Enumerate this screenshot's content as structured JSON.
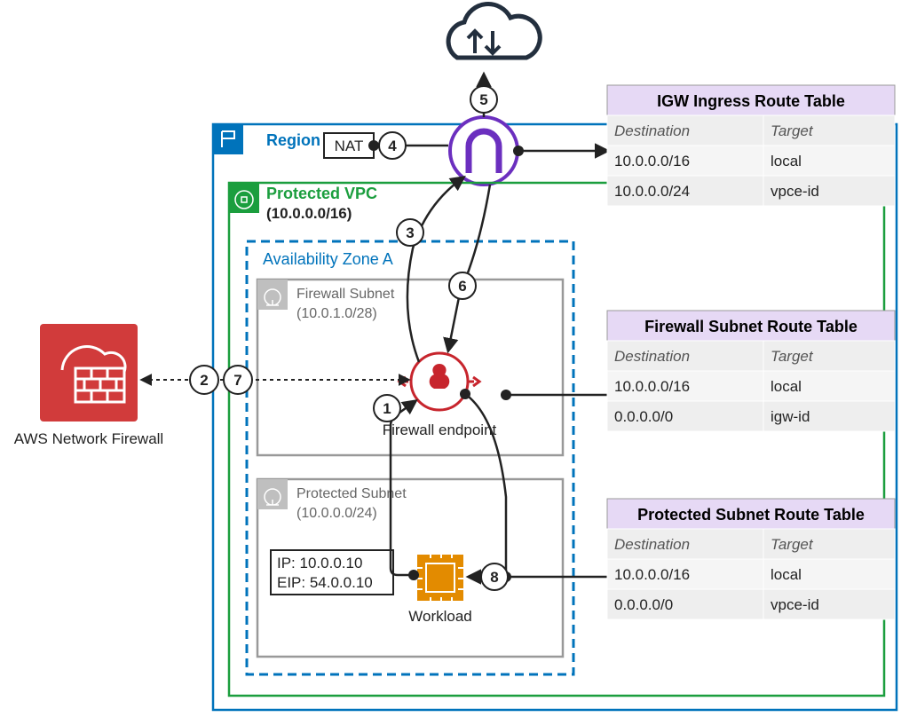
{
  "cloud": {
    "name": "internet-cloud"
  },
  "region_label": "Region",
  "nat_label": "NAT",
  "vpc": {
    "name": "Protected VPC",
    "cidr": "(10.0.0.0/16)"
  },
  "az_label": "Availability Zone A",
  "firewall_subnet": {
    "name": "Firewall Subnet",
    "cidr": "(10.0.1.0/28)",
    "endpoint_label": "Firewall endpoint"
  },
  "protected_subnet": {
    "name": "Protected Subnet",
    "cidr": "(10.0.0.0/24)"
  },
  "workload": {
    "ip_label": "IP: 10.0.0.10",
    "eip_label": "EIP: 54.0.0.10",
    "label": "Workload"
  },
  "anf_label": "AWS Network Firewall",
  "steps": {
    "s1": "1",
    "s2": "2",
    "s3": "3",
    "s4": "4",
    "s5": "5",
    "s6": "6",
    "s7": "7",
    "s8": "8"
  },
  "tables": {
    "igw": {
      "title": "IGW Ingress Route Table",
      "dest_h": "Destination",
      "tgt_h": "Target",
      "r1d": "10.0.0.0/16",
      "r1t": "local",
      "r2d": "10.0.0.0/24",
      "r2t": "vpce-id"
    },
    "fw": {
      "title": "Firewall Subnet Route Table",
      "dest_h": "Destination",
      "tgt_h": "Target",
      "r1d": "10.0.0.0/16",
      "r1t": "local",
      "r2d": "0.0.0.0/0",
      "r2t": "igw-id"
    },
    "prot": {
      "title": "Protected Subnet Route Table",
      "dest_h": "Destination",
      "tgt_h": "Target",
      "r1d": "10.0.0.0/16",
      "r1t": "local",
      "r2d": "0.0.0.0/0",
      "r2t": "vpce-id"
    }
  }
}
